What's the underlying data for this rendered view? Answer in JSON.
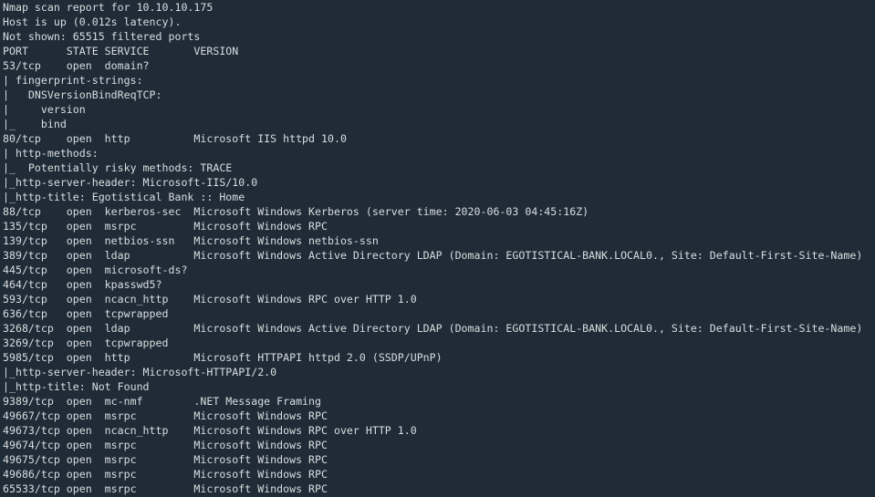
{
  "terminal": {
    "background": "#1f2b36",
    "foreground": "#d9dee3",
    "lines": [
      "Nmap scan report for 10.10.10.175",
      "Host is up (0.012s latency).",
      "Not shown: 65515 filtered ports",
      "PORT      STATE SERVICE       VERSION",
      "53/tcp    open  domain?",
      "| fingerprint-strings:",
      "|   DNSVersionBindReqTCP:",
      "|     version",
      "|_    bind",
      "80/tcp    open  http          Microsoft IIS httpd 10.0",
      "| http-methods:",
      "|_  Potentially risky methods: TRACE",
      "|_http-server-header: Microsoft-IIS/10.0",
      "|_http-title: Egotistical Bank :: Home",
      "88/tcp    open  kerberos-sec  Microsoft Windows Kerberos (server time: 2020-06-03 04:45:16Z)",
      "135/tcp   open  msrpc         Microsoft Windows RPC",
      "139/tcp   open  netbios-ssn   Microsoft Windows netbios-ssn",
      "389/tcp   open  ldap          Microsoft Windows Active Directory LDAP (Domain: EGOTISTICAL-BANK.LOCAL0., Site: Default-First-Site-Name)",
      "445/tcp   open  microsoft-ds?",
      "464/tcp   open  kpasswd5?",
      "593/tcp   open  ncacn_http    Microsoft Windows RPC over HTTP 1.0",
      "636/tcp   open  tcpwrapped",
      "3268/tcp  open  ldap          Microsoft Windows Active Directory LDAP (Domain: EGOTISTICAL-BANK.LOCAL0., Site: Default-First-Site-Name)",
      "3269/tcp  open  tcpwrapped",
      "5985/tcp  open  http          Microsoft HTTPAPI httpd 2.0 (SSDP/UPnP)",
      "|_http-server-header: Microsoft-HTTPAPI/2.0",
      "|_http-title: Not Found",
      "9389/tcp  open  mc-nmf        .NET Message Framing",
      "49667/tcp open  msrpc         Microsoft Windows RPC",
      "49673/tcp open  ncacn_http    Microsoft Windows RPC over HTTP 1.0",
      "49674/tcp open  msrpc         Microsoft Windows RPC",
      "49675/tcp open  msrpc         Microsoft Windows RPC",
      "49686/tcp open  msrpc         Microsoft Windows RPC",
      "65533/tcp open  msrpc         Microsoft Windows RPC"
    ]
  }
}
